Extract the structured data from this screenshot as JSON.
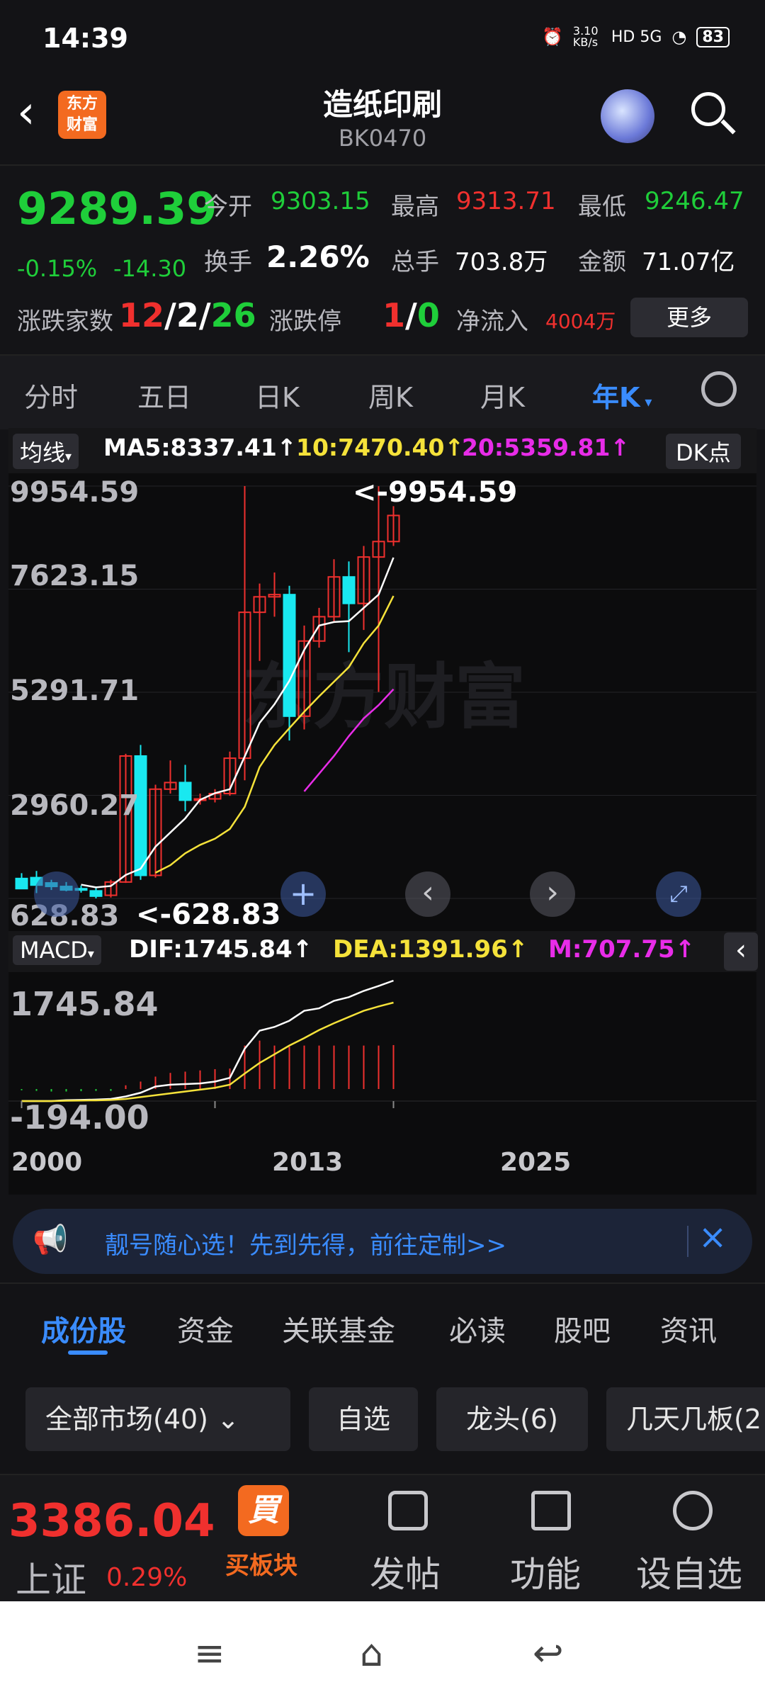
{
  "status_bar": {
    "time": "14:39",
    "speed": "3.10 KB/s",
    "network": "HD 5G",
    "battery": "83"
  },
  "header": {
    "back_icon": "chevron-left-icon",
    "logo_line1": "东方",
    "logo_line2": "财富",
    "title": "造纸印刷",
    "code": "BK0470"
  },
  "quote": {
    "price": "9289.39",
    "change_pct": "-0.15%",
    "change": "-14.30",
    "open_label": "今开",
    "open": "9303.15",
    "high_label": "最高",
    "high": "9313.71",
    "low_label": "最低",
    "low": "9246.47",
    "turnover_label": "换手",
    "turnover": "2.26%",
    "volume_label": "总手",
    "volume": "703.8万",
    "amount_label": "金额",
    "amount": "71.07亿",
    "breadth_label": "涨跌家数",
    "breadth_up": "12",
    "breadth_sep1": "/",
    "breadth_flat": "2",
    "breadth_sep2": "/",
    "breadth_down": "26",
    "limit_label": "涨跌停",
    "limit_up": "1",
    "limit_sep": "/",
    "limit_down": "0",
    "netflow_label": "净流入",
    "netflow": "4004万",
    "more": "更多"
  },
  "kline_tabs": [
    "分时",
    "五日",
    "日K",
    "周K",
    "月K",
    "年K"
  ],
  "kline_active": "年K",
  "ma": {
    "button": "均线",
    "ma5": "MA5:8337.41↑",
    "ma10": "10:7470.40↑",
    "ma20": "20:5359.81↑",
    "dk": "DK点"
  },
  "y_labels": [
    "9954.59",
    "7623.15",
    "5291.71",
    "2960.27",
    "628.83"
  ],
  "annotations": {
    "max": "<-9954.59",
    "min": "<-628.83"
  },
  "macd": {
    "button": "MACD",
    "dif": "DIF:1745.84↑",
    "dea": "DEA:1391.96↑",
    "m": "M:707.75↑",
    "y_top": "1745.84",
    "y_bottom": "-194.00"
  },
  "x_labels": [
    "2000",
    "2013",
    "2025"
  ],
  "ad": {
    "text": "靓号随心选！先到先得，前往定制>>"
  },
  "section_tabs": [
    "成份股",
    "资金",
    "关联基金",
    "必读",
    "股吧",
    "资讯"
  ],
  "filters": [
    "全部市场(40)",
    "自选",
    "龙头(6)",
    "几天几板(2"
  ],
  "bottom": {
    "index_value": "3386.04",
    "index_name": "上证",
    "index_pct": "0.29%",
    "buy_sector": "买板块",
    "post": "发帖",
    "function": "功能",
    "add_watch": "设自选"
  },
  "colors": {
    "up": "#f0302e",
    "down": "#1fce3a",
    "accent": "#3a8cff",
    "ma5": "#ffffff",
    "ma10": "#f5e23a",
    "ma20": "#e82ce8",
    "candle_down": "#19e8f0"
  },
  "chart_data": {
    "type": "candlestick",
    "title": "",
    "ylim": [
      628.83,
      9954.59
    ],
    "max": 9954.59,
    "min": 628.83,
    "candles": [
      {
        "o": 1080,
        "h": 1200,
        "l": 900,
        "c": 850
      },
      {
        "o": 1100,
        "h": 1250,
        "l": 750,
        "c": 930
      },
      {
        "o": 980,
        "h": 1050,
        "l": 820,
        "c": 900
      },
      {
        "o": 900,
        "h": 1000,
        "l": 790,
        "c": 820
      },
      {
        "o": 850,
        "h": 920,
        "l": 760,
        "c": 840
      },
      {
        "o": 800,
        "h": 900,
        "l": 628.83,
        "c": 680
      },
      {
        "o": 700,
        "h": 1050,
        "l": 650,
        "c": 1000
      },
      {
        "o": 1000,
        "h": 3900,
        "l": 980,
        "c": 3850
      },
      {
        "o": 3850,
        "h": 4100,
        "l": 1050,
        "c": 1150
      },
      {
        "o": 1150,
        "h": 3200,
        "l": 1100,
        "c": 3100
      },
      {
        "o": 3100,
        "h": 3750,
        "l": 3000,
        "c": 3250
      },
      {
        "o": 3250,
        "h": 3650,
        "l": 2600,
        "c": 2850
      },
      {
        "o": 2850,
        "h": 3000,
        "l": 2750,
        "c": 2880
      },
      {
        "o": 2880,
        "h": 3100,
        "l": 2800,
        "c": 3000
      },
      {
        "o": 3000,
        "h": 3950,
        "l": 2950,
        "c": 3800
      },
      {
        "o": 3800,
        "h": 9954.59,
        "l": 3300,
        "c": 7100
      },
      {
        "o": 7100,
        "h": 7750,
        "l": 6000,
        "c": 7450
      },
      {
        "o": 7450,
        "h": 8000,
        "l": 7000,
        "c": 7500
      },
      {
        "o": 7500,
        "h": 7700,
        "l": 4200,
        "c": 4750
      },
      {
        "o": 4750,
        "h": 6800,
        "l": 4450,
        "c": 6450
      },
      {
        "o": 6450,
        "h": 7200,
        "l": 6300,
        "c": 7000
      },
      {
        "o": 7000,
        "h": 8300,
        "l": 6900,
        "c": 7900
      },
      {
        "o": 7900,
        "h": 8250,
        "l": 6200,
        "c": 7300
      },
      {
        "o": 7300,
        "h": 8600,
        "l": 6700,
        "c": 8350
      },
      {
        "o": 8350,
        "h": 9950,
        "l": 5300,
        "c": 8700
      },
      {
        "o": 8700,
        "h": 9500,
        "l": 8600,
        "c": 9289.39
      }
    ],
    "ma5": [
      null,
      null,
      null,
      null,
      940,
      880,
      910,
      1160,
      1300,
      1800,
      2120,
      2440,
      2860,
      3010,
      3100,
      3840,
      4600,
      5020,
      5550,
      6250,
      6800,
      6880,
      6900,
      7200,
      7500,
      8337.41
    ],
    "ma10": [
      null,
      null,
      null,
      null,
      null,
      null,
      null,
      null,
      null,
      1210,
      1380,
      1650,
      1840,
      1980,
      2200,
      2700,
      3600,
      4100,
      4480,
      4850,
      5200,
      5530,
      5860,
      6400,
      6800,
      7470.4
    ],
    "ma20": [
      null,
      null,
      null,
      null,
      null,
      null,
      null,
      null,
      null,
      null,
      null,
      null,
      null,
      null,
      null,
      null,
      null,
      null,
      null,
      3050,
      3450,
      3850,
      4300,
      4700,
      5000,
      5359.81
    ],
    "macd_dif": [
      -194,
      -194,
      -194,
      -180,
      -175,
      -170,
      -160,
      -120,
      -60,
      40,
      70,
      80,
      90,
      120,
      180,
      650,
      940,
      1000,
      1100,
      1260,
      1300,
      1420,
      1480,
      1580,
      1660,
      1745.84
    ],
    "macd_dea": [
      -194,
      -194,
      -194,
      -188,
      -185,
      -182,
      -176,
      -160,
      -130,
      -100,
      -70,
      -40,
      -10,
      20,
      70,
      250,
      420,
      560,
      700,
      820,
      950,
      1060,
      1160,
      1260,
      1330,
      1391.96
    ],
    "macd_m": [
      -20,
      -30,
      -40,
      -40,
      -35,
      -30,
      -30,
      60,
      120,
      200,
      260,
      280,
      300,
      320,
      330,
      700,
      780,
      700,
      680,
      700,
      700,
      700,
      700,
      700,
      700,
      707.75
    ],
    "macd_ylim": [
      -194.0,
      1745.84
    ],
    "x_ticks": [
      "2000",
      "2013",
      "2025"
    ]
  }
}
